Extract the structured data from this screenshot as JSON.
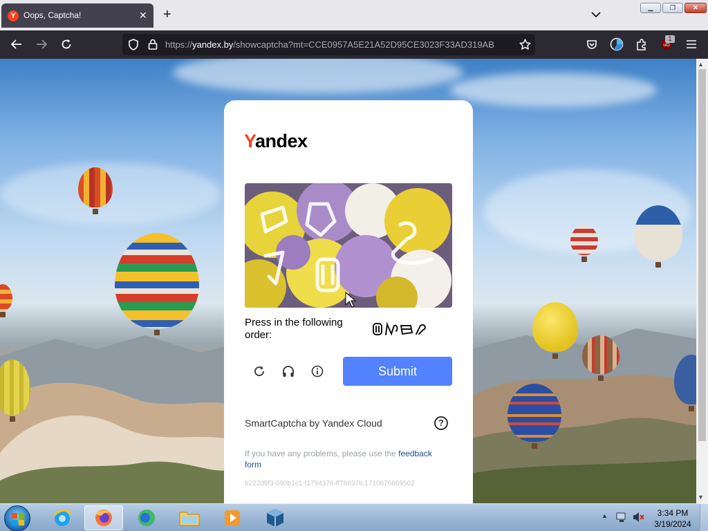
{
  "browser": {
    "tab": {
      "title": "Oops, Captcha!",
      "favicon_letter": "Y"
    },
    "url": {
      "prefix": "https://",
      "host": "yandex.by",
      "rest": "/showcaptcha?mt=CCE0957A5E21A52D95CE3023F33AD319AB"
    },
    "extension_badge": "1"
  },
  "captcha": {
    "logo_first": "Y",
    "logo_rest": "andex",
    "instruction": "Press in the following order:",
    "submit_label": "Submit",
    "brand": "SmartCaptcha by Yandex Cloud",
    "problem_text": "If you have any problems, please use the ",
    "feedback_link": "feedback form",
    "hash": "b222d9f3-690b1c1-f1794376-ff78697b:1710876869502",
    "help_symbol": "?"
  },
  "taskbar": {
    "time": "3:34 PM",
    "date": "3/19/2024"
  },
  "colors": {
    "accent": "#5282ff",
    "brand_red": "#fc3f1d",
    "link": "#1c4b8f"
  },
  "icons": [
    "back-icon",
    "forward-icon",
    "reload-icon",
    "shield-icon",
    "lock-icon",
    "star-icon",
    "pocket-icon",
    "account-icon",
    "extensions-icon",
    "ublock-icon",
    "menu-icon",
    "refresh-icon",
    "headphones-icon",
    "info-icon",
    "help-icon"
  ]
}
